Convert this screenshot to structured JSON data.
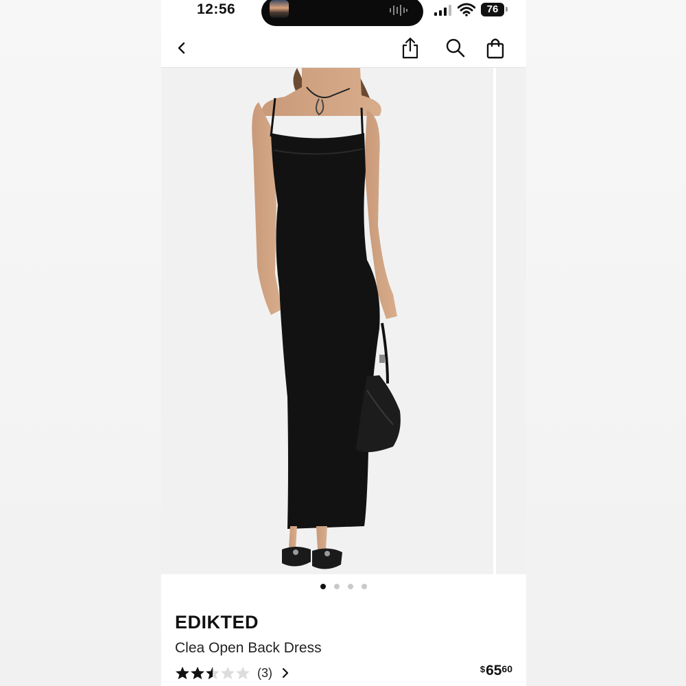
{
  "status_bar": {
    "time": "12:56",
    "battery": "76"
  },
  "nav": {
    "icons": [
      "chevron-left-icon",
      "share-icon",
      "search-icon",
      "shopping-bag-icon"
    ]
  },
  "carousel": {
    "image": "black spaghetti-strap maxi dress on model holding black shoulder bag",
    "page_count": 4,
    "active_index": 0
  },
  "product": {
    "brand": "EDIKTED",
    "name": "Clea Open Back Dress",
    "rating_out_of_5": 2.5,
    "review_count": "(3)",
    "price_currency": "$",
    "price_dollars": "65",
    "price_cents": "60"
  },
  "colors": {
    "accent": "#111111",
    "star": "#111111",
    "star_empty": "#dcdcdc"
  }
}
